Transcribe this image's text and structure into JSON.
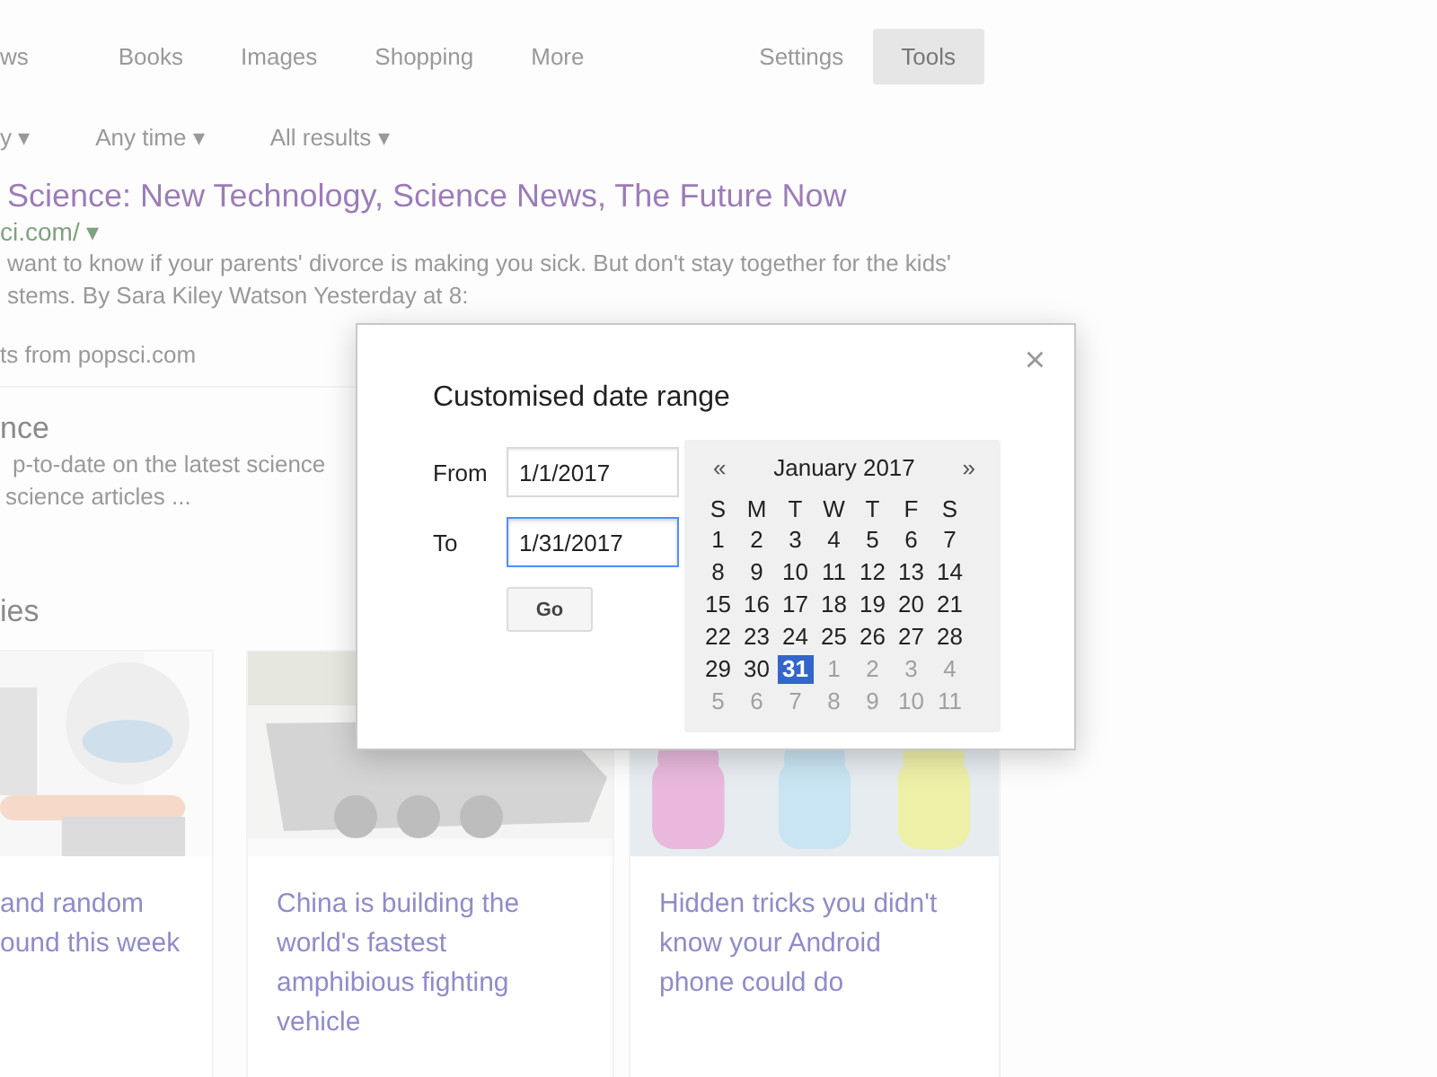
{
  "nav_tabs": [
    {
      "label": "ws",
      "selected": false
    },
    {
      "label": "Books",
      "selected": false
    },
    {
      "label": "Images",
      "selected": false
    },
    {
      "label": "Shopping",
      "selected": false
    },
    {
      "label": "More",
      "selected": false
    }
  ],
  "nav_right": [
    {
      "label": "Settings",
      "selected": false
    },
    {
      "label": "Tools",
      "selected": true
    }
  ],
  "filters": [
    {
      "label": "y ▾"
    },
    {
      "label": "Any time ▾"
    },
    {
      "label": "All results ▾"
    }
  ],
  "result": {
    "title": "Science: New Technology, Science News, The Future Now",
    "url": "ci.com/ ▾",
    "snippet": [
      "want to know if your parents' divorce is making you sick. But don't stay together for the kids'",
      "stems. By Sara Kiley Watson Yesterday at 8:"
    ]
  },
  "more_link": "ts from popsci.com",
  "second_result": {
    "title": "nce",
    "snippet": [
      "p-to-date on the latest science",
      "science articles ..."
    ]
  },
  "section_heading": "ies",
  "cards": [
    {
      "kind": "picture",
      "title": [
        "and random",
        "ound this week"
      ]
    },
    {
      "kind": "picture",
      "title": [
        "China is building the",
        "world's fastest",
        "amphibious fighting",
        "vehicle"
      ]
    },
    {
      "kind": "picture",
      "title": [
        "Hidden tricks you didn't",
        "know your Android",
        "phone could do"
      ]
    }
  ],
  "dialog": {
    "title": "Customised date range",
    "close": "×",
    "from_label": "From",
    "from_value": "1/1/2017",
    "to_label": "To",
    "to_value": "1/31/2017",
    "to_focused": true,
    "go": "Go",
    "calendar": {
      "prev": "«",
      "month": "January 2017",
      "next": "»",
      "weekdays": [
        "S",
        "M",
        "T",
        "W",
        "T",
        "F",
        "S"
      ],
      "weeks": [
        [
          {
            "label": "1",
            "selected": false,
            "outside": false
          },
          {
            "label": "2",
            "selected": false,
            "outside": false
          },
          {
            "label": "3",
            "selected": false,
            "outside": false
          },
          {
            "label": "4",
            "selected": false,
            "outside": false
          },
          {
            "label": "5",
            "selected": false,
            "outside": false
          },
          {
            "label": "6",
            "selected": false,
            "outside": false
          },
          {
            "label": "7",
            "selected": false,
            "outside": false
          }
        ],
        [
          {
            "label": "8",
            "selected": false,
            "outside": false
          },
          {
            "label": "9",
            "selected": false,
            "outside": false
          },
          {
            "label": "10",
            "selected": false,
            "outside": false
          },
          {
            "label": "11",
            "selected": false,
            "outside": false
          },
          {
            "label": "12",
            "selected": false,
            "outside": false
          },
          {
            "label": "13",
            "selected": false,
            "outside": false
          },
          {
            "label": "14",
            "selected": false,
            "outside": false
          }
        ],
        [
          {
            "label": "15",
            "selected": false,
            "outside": false
          },
          {
            "label": "16",
            "selected": false,
            "outside": false
          },
          {
            "label": "17",
            "selected": false,
            "outside": false
          },
          {
            "label": "18",
            "selected": false,
            "outside": false
          },
          {
            "label": "19",
            "selected": false,
            "outside": false
          },
          {
            "label": "20",
            "selected": false,
            "outside": false
          },
          {
            "label": "21",
            "selected": false,
            "outside": false
          }
        ],
        [
          {
            "label": "22",
            "selected": false,
            "outside": false
          },
          {
            "label": "23",
            "selected": false,
            "outside": false
          },
          {
            "label": "24",
            "selected": false,
            "outside": false
          },
          {
            "label": "25",
            "selected": false,
            "outside": false
          },
          {
            "label": "26",
            "selected": false,
            "outside": false
          },
          {
            "label": "27",
            "selected": false,
            "outside": false
          },
          {
            "label": "28",
            "selected": false,
            "outside": false
          }
        ],
        [
          {
            "label": "29",
            "selected": false,
            "outside": false
          },
          {
            "label": "30",
            "selected": false,
            "outside": false
          },
          {
            "label": "31",
            "selected": true,
            "outside": false
          },
          {
            "label": "1",
            "selected": false,
            "outside": true
          },
          {
            "label": "2",
            "selected": false,
            "outside": true
          },
          {
            "label": "3",
            "selected": false,
            "outside": true
          },
          {
            "label": "4",
            "selected": false,
            "outside": true
          }
        ],
        [
          {
            "label": "5",
            "selected": false,
            "outside": true
          },
          {
            "label": "6",
            "selected": false,
            "outside": true
          },
          {
            "label": "7",
            "selected": false,
            "outside": true
          },
          {
            "label": "8",
            "selected": false,
            "outside": true
          },
          {
            "label": "9",
            "selected": false,
            "outside": true
          },
          {
            "label": "10",
            "selected": false,
            "outside": true
          },
          {
            "label": "11",
            "selected": false,
            "outside": true
          }
        ]
      ]
    }
  }
}
